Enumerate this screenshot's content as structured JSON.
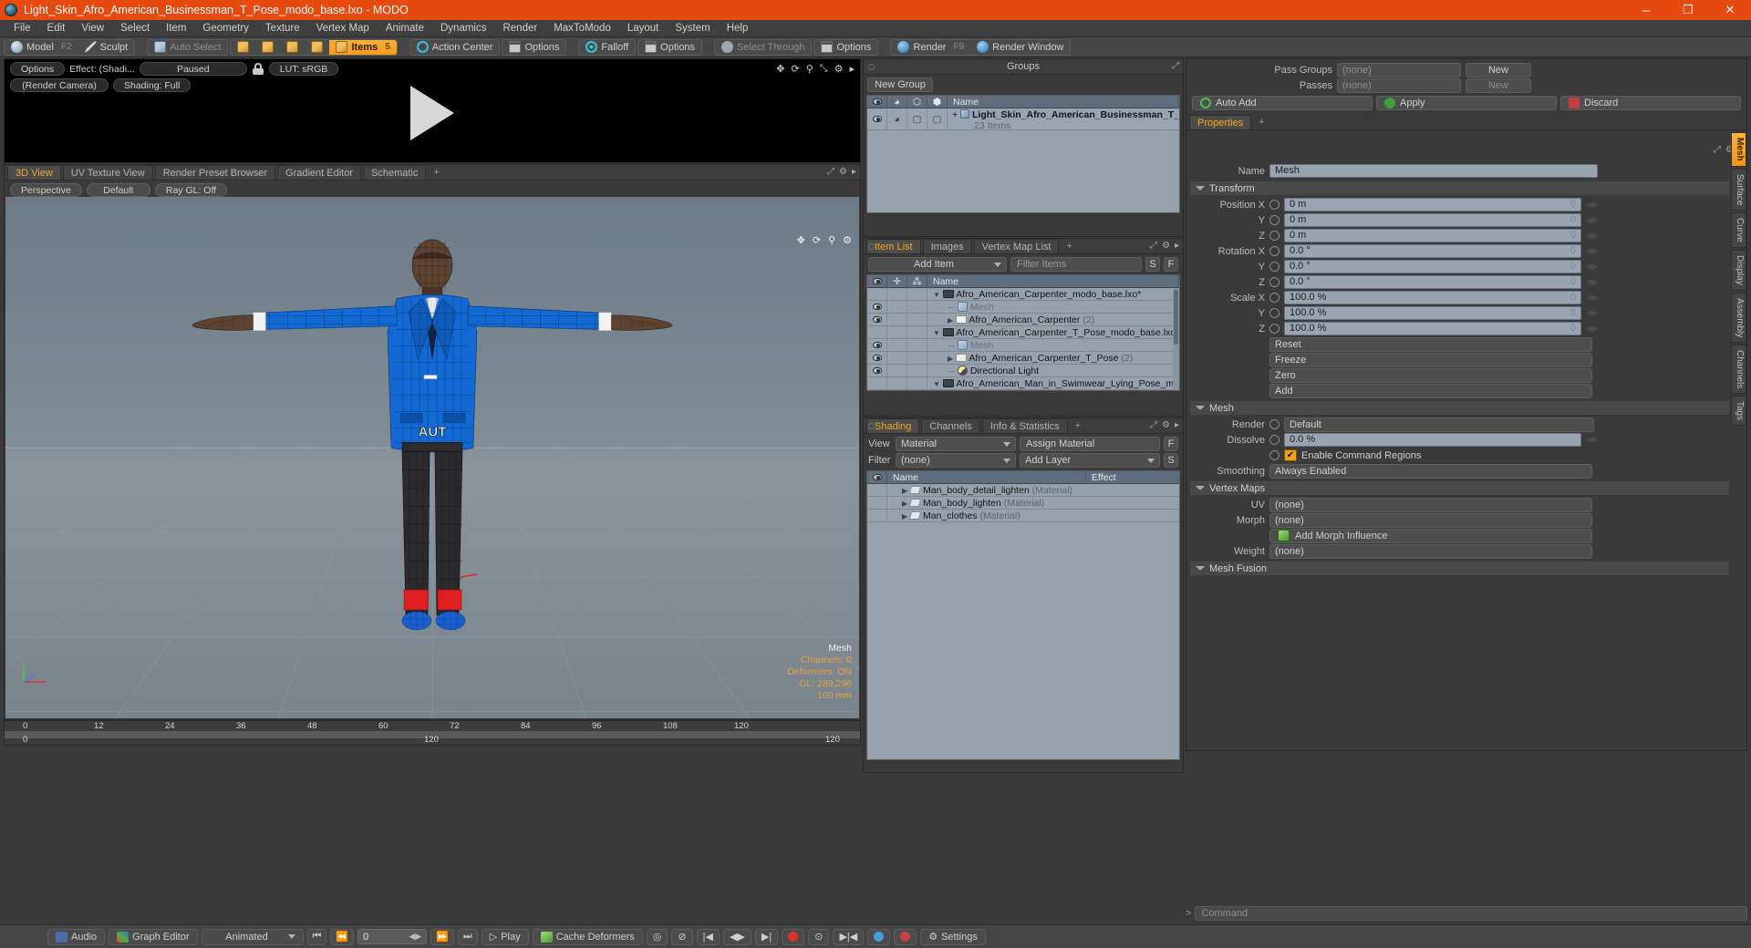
{
  "window": {
    "title": "Light_Skin_Afro_American_Businessman_T_Pose_modo_base.lxo - MODO",
    "minimize": "─",
    "maximize": "❐",
    "close": "✕"
  },
  "menu": [
    "File",
    "Edit",
    "View",
    "Select",
    "Item",
    "Geometry",
    "Texture",
    "Vertex Map",
    "Animate",
    "Dynamics",
    "Render",
    "MaxToModo",
    "Layout",
    "System",
    "Help"
  ],
  "toolbar": {
    "model": "Model",
    "model_hk": "F2",
    "sculpt": "Sculpt",
    "auto_select": "Auto Select",
    "items": "Items",
    "items_hk": "5",
    "action_center": "Action Center",
    "options1": "Options",
    "falloff": "Falloff",
    "options2": "Options",
    "select_through": "Select Through",
    "options3": "Options",
    "render": "Render",
    "render_hk": "F9",
    "render_window": "Render Window"
  },
  "render_preview": {
    "options": "Options",
    "effect": "Effect: (Shadi...",
    "paused": "Paused",
    "lut": "LUT: sRGB",
    "camera": "(Render Camera)",
    "shading": "Shading: Full"
  },
  "viewport": {
    "tabs": [
      "3D View",
      "UV Texture View",
      "Render Preset Browser",
      "Gradient Editor",
      "Schematic"
    ],
    "tab_plus": "+",
    "active_tab": "3D View",
    "sub": [
      "Perspective",
      "Default",
      "Ray GL: Off"
    ],
    "stats": {
      "title": "Mesh",
      "channels": "Channels: 0",
      "deformers": "Deformers: ON",
      "gl": "GL: 289,296",
      "scale": "100 mm"
    },
    "ruler_top": [
      "0",
      "12",
      "24",
      "36",
      "48",
      "60",
      "72",
      "84",
      "96",
      "108",
      "120"
    ],
    "ruler_mid": "120",
    "ruler_left": "0",
    "ruler_right": "120"
  },
  "groups": {
    "title": "Groups",
    "new_group": "New Group",
    "columns": [
      "eye-column",
      "shade-column",
      "poly-column",
      "item-column",
      "Name"
    ],
    "rows": [
      {
        "name": "Light_Skin_Afro_American_Businessman_T_Pos...",
        "sub": "23 Items",
        "expand": "+"
      }
    ]
  },
  "item_list": {
    "tabs": [
      "Item List",
      "Images",
      "Vertex Map List"
    ],
    "tab_plus": "+",
    "active_tab": "Item List",
    "add_item": "Add Item",
    "filter_placeholder": "Filter Items",
    "btn_s": "S",
    "btn_f": "F",
    "columns": [
      "eye-column",
      "lock-column",
      "axis-column",
      "Name"
    ],
    "rows": [
      {
        "name": "Afro_American_Carpenter_modo_base.lxo*",
        "suffix": "",
        "icon": "scene-icon",
        "indent": 0,
        "caret": "down",
        "eye": false
      },
      {
        "name": "Mesh",
        "suffix": "",
        "icon": "mesh-icon",
        "indent": 1,
        "caret": "dot",
        "eye": true,
        "muted": true
      },
      {
        "name": "Afro_American_Carpenter",
        "suffix": "(2)",
        "icon": "folder-icon",
        "indent": 1,
        "caret": "right",
        "eye": true
      },
      {
        "name": "Afro_American_Carpenter_T_Pose_modo_base.lxo",
        "suffix": "",
        "icon": "scene-icon",
        "indent": 0,
        "caret": "down",
        "eye": false
      },
      {
        "name": "Mesh",
        "suffix": "",
        "icon": "mesh-icon",
        "indent": 1,
        "caret": "dot",
        "eye": true,
        "muted": true
      },
      {
        "name": "Afro_American_Carpenter_T_Pose",
        "suffix": "(2)",
        "icon": "folder-icon",
        "indent": 1,
        "caret": "right",
        "eye": true
      },
      {
        "name": "Directional Light",
        "suffix": "",
        "icon": "light-icon",
        "indent": 1,
        "caret": "dot",
        "eye": true
      },
      {
        "name": "Afro_American_Man_in_Swimwear_Lying_Pose_modo_bas …",
        "suffix": "",
        "icon": "scene-icon",
        "indent": 0,
        "caret": "down",
        "eye": false
      }
    ]
  },
  "shading": {
    "tabs": [
      "Shading",
      "Channels",
      "Info & Statistics"
    ],
    "tab_plus": "+",
    "active_tab": "Shading",
    "view_label": "View",
    "view_value": "Material",
    "assign_material": "Assign Material",
    "filter_label": "Filter",
    "filter_value": "(none)",
    "add_layer": "Add Layer",
    "btn_f": "F",
    "btn_s": "S",
    "columns": [
      "eye-column",
      "Name",
      "Effect"
    ],
    "rows": [
      {
        "name": "Man_body_detail_lighten",
        "kind": "(Material)",
        "effect": ""
      },
      {
        "name": "Man_body_lighten",
        "kind": "(Material)",
        "effect": ""
      },
      {
        "name": "Man_clothes",
        "kind": "(Material)",
        "effect": ""
      }
    ]
  },
  "properties": {
    "pass_groups_label": "Pass Groups",
    "pass_groups_value": "(none)",
    "pass_groups_new": "New",
    "passes_label": "Passes",
    "passes_value": "(none)",
    "passes_new": "New",
    "auto_add": "Auto Add",
    "apply": "Apply",
    "discard": "Discard",
    "tab": "Properties",
    "tab_plus": "+",
    "name_label": "Name",
    "name_value": "Mesh",
    "transform_section": "Transform",
    "position": {
      "label": "Position X",
      "x": "0 m",
      "y": "0 m",
      "z": "0 m",
      "yl": "Y",
      "zl": "Z"
    },
    "rotation": {
      "label": "Rotation X",
      "x": "0.0 °",
      "y": "0.0 °",
      "z": "0.0 °",
      "yl": "Y",
      "zl": "Z"
    },
    "scale": {
      "label": "Scale X",
      "x": "100.0 %",
      "y": "100.0 %",
      "z": "100.0 %",
      "yl": "Y",
      "zl": "Z"
    },
    "actions": [
      "Reset",
      "Freeze",
      "Zero",
      "Add"
    ],
    "mesh_section": "Mesh",
    "render_label": "Render",
    "render_value": "Default",
    "dissolve_label": "Dissolve",
    "dissolve_value": "0.0 %",
    "enable_cmd_regions": "Enable Command Regions",
    "smoothing_label": "Smoothing",
    "smoothing_value": "Always Enabled",
    "vertex_maps_section": "Vertex Maps",
    "uv_label": "UV",
    "uv_value": "(none)",
    "morph_label": "Morph",
    "morph_value": "(none)",
    "add_morph_influence": "Add Morph Influence",
    "weight_label": "Weight",
    "weight_value": "(none)",
    "mesh_fusion_section": "Mesh Fusion",
    "side_tabs": [
      "Mesh",
      "Surface",
      "Curve",
      "Display",
      "Assembly",
      "Channels",
      "Tags"
    ],
    "side_tab_active": "Mesh"
  },
  "bottom": {
    "audio": "Audio",
    "graph_editor": "Graph Editor",
    "animated": "Animated",
    "frame": "0",
    "play": "Play",
    "cache_deformers": "Cache Deformers",
    "settings": "Settings",
    "command_placeholder": "Command"
  },
  "colors": {
    "title_bar": "#e64a0e",
    "accent": "#f5a623",
    "panel_bg": "#3a3a3a",
    "list_bg": "#97a1ac",
    "record_red": "#e03030"
  }
}
